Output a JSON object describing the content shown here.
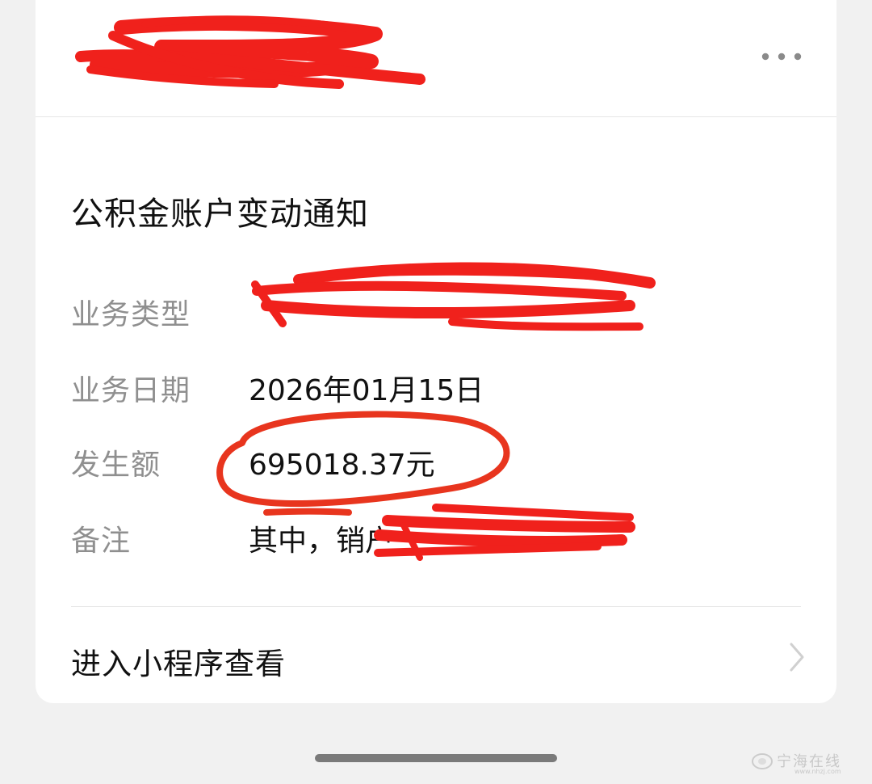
{
  "header": {
    "sender_name": "",
    "more_icon": "more-horizontal-icon"
  },
  "notice": {
    "title": "公积金账户变动通知",
    "rows": [
      {
        "label": "业务类型",
        "value": ""
      },
      {
        "label": "业务日期",
        "value": "2026年01月15日"
      },
      {
        "label": "发生额",
        "value": "695018.37元"
      },
      {
        "label": "备注",
        "value": "其中，销户"
      }
    ]
  },
  "footer": {
    "link_label": "进入小程序查看",
    "chevron_icon": "chevron-right-icon"
  },
  "watermark": {
    "text": "宁海在线",
    "subtext": "www.nhzj.com"
  },
  "colors": {
    "redaction": "#f0211c",
    "circle": "#e8351e",
    "label": "#8f8f8f",
    "value": "#111111"
  }
}
